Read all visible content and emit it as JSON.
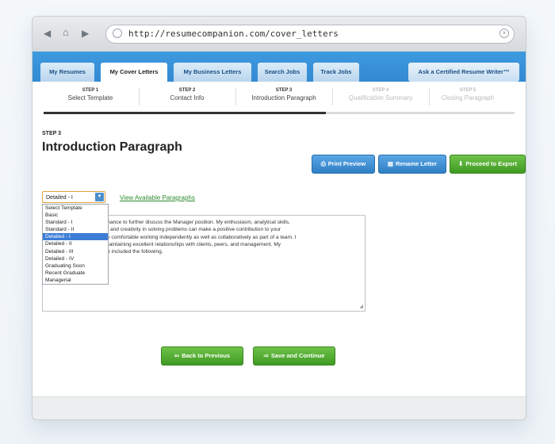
{
  "browser": {
    "url": "http://resumecompanion.com/cover_letters",
    "back_icon": "back-arrow",
    "home_icon": "home",
    "forward_icon": "forward-arrow",
    "globe_icon": "globe",
    "clear_icon": "clear-x"
  },
  "tabs": [
    {
      "label": "My Resumes"
    },
    {
      "label": "My Cover Letters",
      "active": true
    },
    {
      "label": "My Business Letters"
    },
    {
      "label": "Search Jobs"
    },
    {
      "label": "Track Jobs"
    }
  ],
  "ask_writer": "Ask a Certified Resume Writer™",
  "steps": [
    {
      "num": "STEP 1",
      "label": "Select Template",
      "active": true
    },
    {
      "num": "STEP 2",
      "label": "Contact Info",
      "active": true
    },
    {
      "num": "STEP 3",
      "label": "Introduction Paragraph",
      "active": true
    },
    {
      "num": "STEP 4",
      "label": "Qualification Summary",
      "active": false
    },
    {
      "num": "STEP 5",
      "label": "Closing Paragraph",
      "active": false
    }
  ],
  "progress_steps_completed": 3,
  "progress_steps_total": 5,
  "section": {
    "step_label": "STEP 3",
    "title": "Introduction Paragraph"
  },
  "actions": {
    "print_preview": "Print Preview",
    "rename_letter": "Rename Letter",
    "proceed_export": "Proceed to Export"
  },
  "template_select": {
    "value": "Detailed - I",
    "options": [
      "Select Template",
      "Basic",
      "Standard - I",
      "Standard - II",
      "Detailed - I",
      "Detailed - II",
      "Detailed - III",
      "Detailed - IV",
      "Graduating Soon",
      "Recent Graduate",
      "Managerial"
    ],
    "selected_index": 4
  },
  "view_link": "View Available Paragraphs",
  "paragraph_lines": [
    "chance to further discuss the Manager position.  My enthusiasm, analytical skills,",
    "s, and creativity in solving problems can make a positive contribution to your",
    "tly comfortable working independently as well as collaboratively as part of a team.  I",
    "maintaining excellent relationships with clients, peers, and management.  My",
    "ve included the following."
  ],
  "nav": {
    "back": "Back to Previous",
    "save": "Save and Continue"
  },
  "colors": {
    "tab_bar": "#2a80c9",
    "primary_button": "#2f7fc4",
    "success_button": "#3f9a22",
    "link": "#2f8c2f",
    "selected_option": "#3c7dd6"
  }
}
